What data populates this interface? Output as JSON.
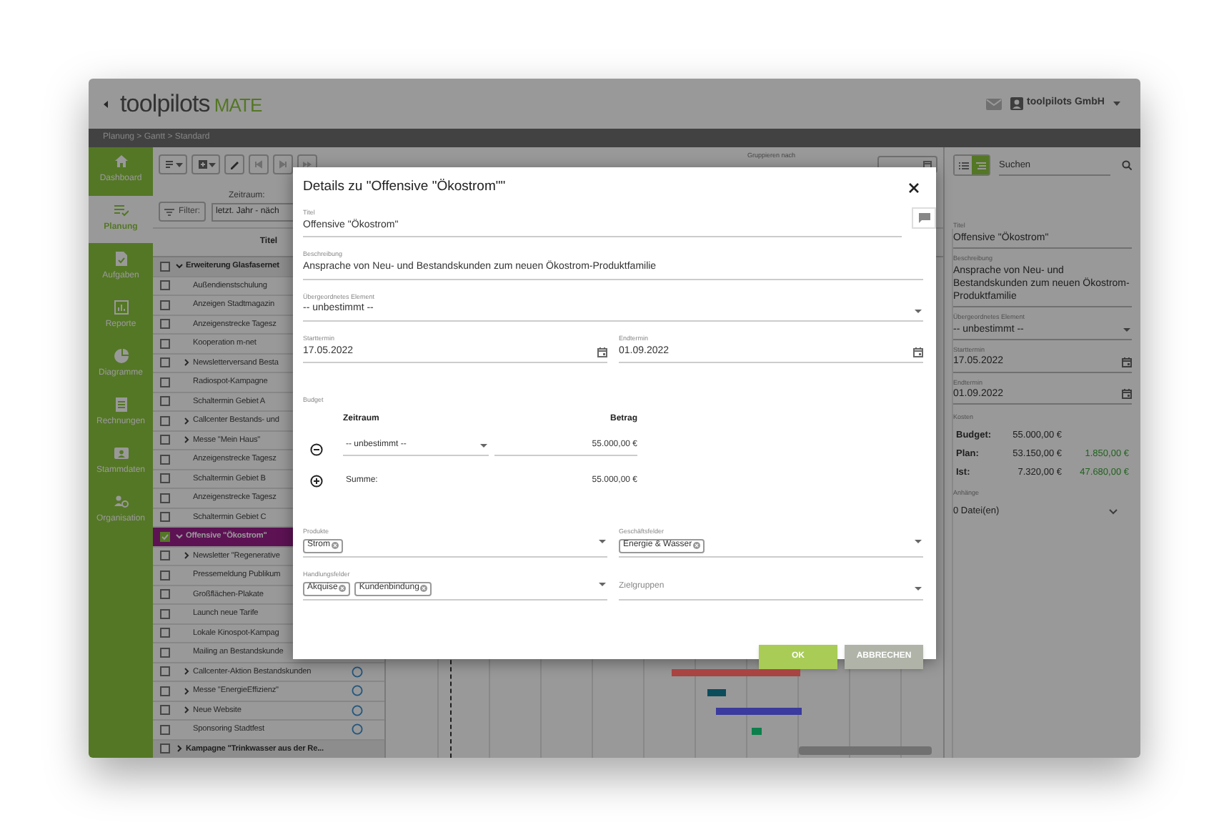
{
  "app": {
    "logo_main": "toolpilots",
    "logo_accent": "MATE",
    "company": "toolpilots GmbH"
  },
  "breadcrumb": "Planung > Gantt > Standard",
  "sidebar": [
    {
      "label": "Dashboard",
      "kind": "home",
      "selected": false
    },
    {
      "label": "Planung",
      "kind": "planning",
      "selected": true
    },
    {
      "label": "Aufgaben",
      "kind": "tasks",
      "selected": false
    },
    {
      "label": "Reporte",
      "kind": "reports",
      "selected": false
    },
    {
      "label": "Diagramme",
      "kind": "charts",
      "selected": false
    },
    {
      "label": "Rechnungen",
      "kind": "invoices",
      "selected": false
    },
    {
      "label": "Stammdaten",
      "kind": "masterdata",
      "selected": false
    },
    {
      "label": "Organisation",
      "kind": "organisation",
      "selected": false
    }
  ],
  "toolbar": {
    "group_label": "Gruppieren nach",
    "filter_label": "Filter:",
    "period_label": "Zeitraum:",
    "period_value": "letzt. Jahr - näch",
    "search_placeholder": "Suchen"
  },
  "view_toggle": [
    {
      "kind": "list",
      "selected": false
    },
    {
      "kind": "gantt",
      "selected": true
    }
  ],
  "list": {
    "column": "Titel",
    "rows": [
      {
        "title": "Erweiterung Glasfasernet",
        "kind": "group",
        "expandable": true,
        "expanded": true,
        "checked": false,
        "selected": false,
        "status_circle": false
      },
      {
        "title": "Außendienstschulung",
        "kind": "item",
        "expandable": false,
        "checked": false,
        "selected": false,
        "status_circle": false
      },
      {
        "title": "Anzeigen Stadtmagazin",
        "kind": "item",
        "expandable": false,
        "checked": false,
        "selected": false,
        "status_circle": false
      },
      {
        "title": "Anzeigenstrecke Tagesz",
        "kind": "item",
        "expandable": false,
        "checked": false,
        "selected": false,
        "status_circle": false
      },
      {
        "title": "Kooperation m-net",
        "kind": "item",
        "expandable": false,
        "checked": false,
        "selected": false,
        "status_circle": false
      },
      {
        "title": "Newsletterversand Besta",
        "kind": "item",
        "expandable": true,
        "expanded": false,
        "checked": false,
        "selected": false,
        "status_circle": false
      },
      {
        "title": "Radiospot-Kampagne",
        "kind": "item",
        "expandable": false,
        "checked": false,
        "selected": false,
        "status_circle": false
      },
      {
        "title": "Schaltermin Gebiet A",
        "kind": "item",
        "expandable": false,
        "checked": false,
        "selected": false,
        "status_circle": false
      },
      {
        "title": "Callcenter Bestands- und",
        "kind": "item",
        "expandable": true,
        "expanded": false,
        "checked": false,
        "selected": false,
        "status_circle": false
      },
      {
        "title": "Messe \"Mein Haus\"",
        "kind": "item",
        "expandable": true,
        "expanded": false,
        "checked": false,
        "selected": false,
        "status_circle": false
      },
      {
        "title": "Anzeigenstrecke Tagesz",
        "kind": "item",
        "expandable": false,
        "checked": false,
        "selected": false,
        "status_circle": false
      },
      {
        "title": "Schaltermin Gebiet B",
        "kind": "item",
        "expandable": false,
        "checked": false,
        "selected": false,
        "status_circle": false
      },
      {
        "title": "Anzeigenstrecke Tagesz",
        "kind": "item",
        "expandable": false,
        "checked": false,
        "selected": false,
        "status_circle": false
      },
      {
        "title": "Schaltermin Gebiet C",
        "kind": "item",
        "expandable": false,
        "checked": false,
        "selected": false,
        "status_circle": false
      },
      {
        "title": "Offensive \"Ökostrom\"",
        "kind": "group",
        "expandable": true,
        "expanded": true,
        "checked": true,
        "selected": true,
        "status_circle": false
      },
      {
        "title": "Newsletter \"Regenerative",
        "kind": "item",
        "expandable": true,
        "expanded": false,
        "checked": false,
        "selected": false,
        "status_circle": false
      },
      {
        "title": "Pressemeldung Publikum",
        "kind": "item",
        "expandable": false,
        "checked": false,
        "selected": false,
        "status_circle": false
      },
      {
        "title": "Großflächen-Plakate",
        "kind": "item",
        "expandable": false,
        "checked": false,
        "selected": false,
        "status_circle": false
      },
      {
        "title": "Launch neue Tarife",
        "kind": "item",
        "expandable": false,
        "checked": false,
        "selected": false,
        "status_circle": false
      },
      {
        "title": "Lokale Kinospot-Kampag",
        "kind": "item",
        "expandable": false,
        "checked": false,
        "selected": false,
        "status_circle": false
      },
      {
        "title": "Mailing an Bestandskunde",
        "kind": "item",
        "expandable": false,
        "checked": false,
        "selected": false,
        "status_circle": false
      },
      {
        "title": "Callcenter-Aktion Bestandskunden",
        "kind": "item",
        "expandable": true,
        "expanded": false,
        "checked": false,
        "selected": false,
        "status_circle": true,
        "color": "#a84442"
      },
      {
        "title": "Messe \"EnergieEffizienz\"",
        "kind": "item",
        "expandable": true,
        "expanded": false,
        "checked": false,
        "selected": false,
        "status_circle": true,
        "color": "#0c4d5c"
      },
      {
        "title": "Neue Website",
        "kind": "item",
        "expandable": true,
        "expanded": false,
        "checked": false,
        "selected": false,
        "status_circle": true,
        "color": "#3b3a9e"
      },
      {
        "title": "Sponsoring Stadtfest",
        "kind": "item",
        "expandable": false,
        "checked": false,
        "selected": false,
        "status_circle": true,
        "color": "#0c7f4c"
      },
      {
        "title": "Kampagne \"Trinkwasser aus der Re...",
        "kind": "group",
        "expandable": true,
        "expanded": false,
        "checked": false,
        "selected": false,
        "status_circle": false
      }
    ]
  },
  "details": {
    "title_label": "Titel",
    "title": "Offensive \"Ökostrom\"",
    "description_label": "Beschreibung",
    "description": "Ansprache von Neu- und Bestandskunden zum neuen Ökostrom-Produktfamilie",
    "parent_label": "Übergeordnetes Element",
    "parent": "-- unbestimmt --",
    "start_label": "Starttermin",
    "start": "17.05.2022",
    "end_label": "Endtermin",
    "end": "01.09.2022",
    "costs_label": "Kosten",
    "costs": [
      {
        "label": "Budget:",
        "amount": "55.000,00 €"
      },
      {
        "label": "Plan:",
        "amount": "53.150,00 €",
        "rest": "1.850,00 €"
      },
      {
        "label": "Ist:",
        "amount": "7.320,00 €",
        "rest": "47.680,00 €"
      }
    ],
    "attachments_label": "Anhänge",
    "attachments": "0 Datei(en)"
  },
  "modal": {
    "heading": "Details zu \"Offensive \"Ökostrom\"\"",
    "title_label": "Titel",
    "title": "Offensive \"Ökostrom\"",
    "description_label": "Beschreibung",
    "description": "Ansprache von Neu- und Bestandskunden zum neuen Ökostrom-Produktfamilie",
    "parent_label": "Übergeordnetes Element",
    "parent": "-- unbestimmt --",
    "start_label": "Starttermin",
    "start": "17.05.2022",
    "end_label": "Endtermin",
    "end": "01.09.2022",
    "budget": {
      "label": "Budget",
      "col_period": "Zeitraum",
      "col_amount": "Betrag",
      "rows": [
        {
          "period": "-- unbestimmt --",
          "amount": "55.000,00 €"
        }
      ],
      "sum_label": "Summe:",
      "sum": "55.000,00 €"
    },
    "tag_fields": [
      {
        "label": "Produkte",
        "tags": [
          "Strom"
        ]
      },
      {
        "label": "Geschäftsfelder",
        "tags": [
          "Energie & Wasser"
        ]
      },
      {
        "label": "Handlungsfelder",
        "tags": [
          "Akquise",
          "Kundenbindung"
        ]
      },
      {
        "placeholder": "Zielgruppen"
      }
    ],
    "ok": "OK",
    "cancel": "ABBRECHEN"
  }
}
